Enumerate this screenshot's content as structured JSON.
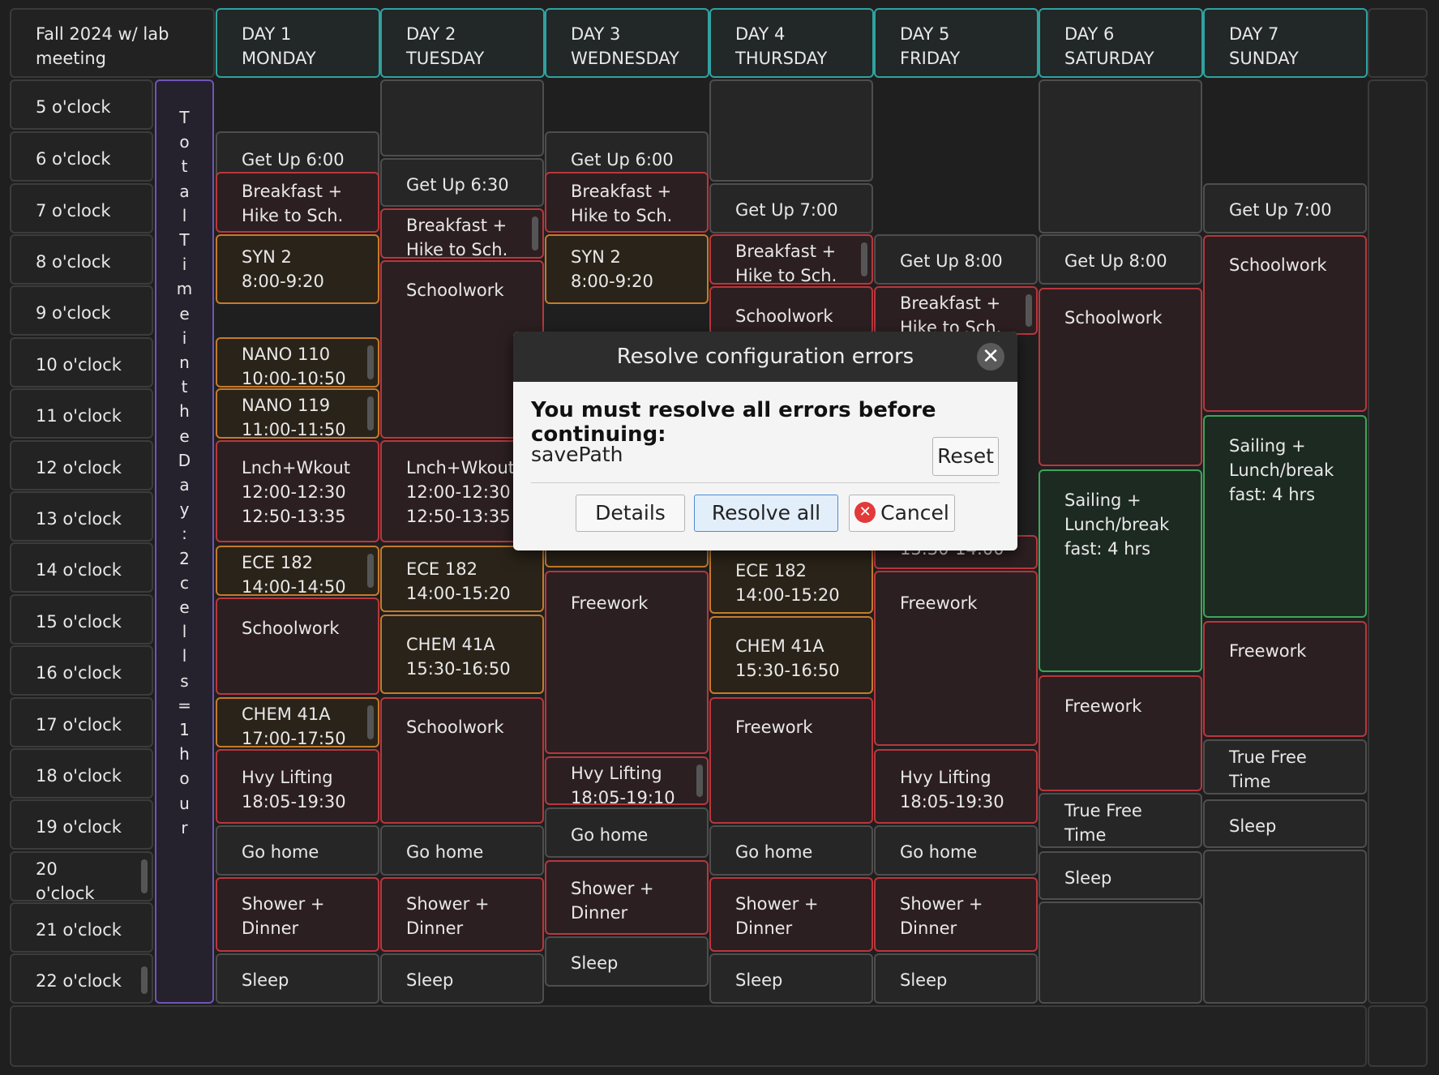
{
  "header": {
    "corner_title": "Fall 2024 w/ lab\nmeeting",
    "days": [
      {
        "line1": "DAY 1",
        "line2": "MONDAY"
      },
      {
        "line1": "DAY 2",
        "line2": "TUESDAY"
      },
      {
        "line1": "DAY 3",
        "line2": "WEDNESDAY"
      },
      {
        "line1": "DAY 4",
        "line2": "THURSDAY"
      },
      {
        "line1": "DAY 5",
        "line2": "FRIDAY"
      },
      {
        "line1": "DAY 6",
        "line2": "SATURDAY"
      },
      {
        "line1": "DAY 7",
        "line2": "SUNDAY"
      }
    ]
  },
  "hours": [
    "5 o'clock",
    "6 o'clock",
    "7 o'clock",
    "8 o'clock",
    "9 o'clock",
    "10 o'clock",
    "11 o'clock",
    "12 o'clock",
    "13 o'clock",
    "14 o'clock",
    "15 o'clock",
    "16 o'clock",
    "17 o'clock",
    "18 o'clock",
    "19 o'clock",
    "20\no'clock",
    "21 o'clock",
    "22 o'clock"
  ],
  "vertical_note": "TotalTimeintheDay:2cells=1hour",
  "schedule": {
    "day1": [
      "Get Up 6:00",
      "Breakfast +\nHike to Sch.",
      "SYN 2\n8:00-9:20",
      "NANO 110\n10:00-10:50",
      "NANO 119\n11:00-11:50",
      "Lnch+Wkout\n12:00-12:30\n12:50-13:35",
      "ECE 182\n14:00-14:50",
      "Schoolwork",
      "CHEM 41A\n17:00-17:50",
      "Hvy Lifting\n18:05-19:30",
      "Go home",
      "Shower +\nDinner",
      "Sleep"
    ],
    "day2": [
      "Get Up 6:30",
      "Breakfast +\nHike to Sch.",
      "Schoolwork",
      "Lnch+Wkout\n12:00-12:30\n12:50-13:35",
      "ECE 182\n14:00-15:20",
      "CHEM 41A\n15:30-16:50",
      "Schoolwork",
      "Go home",
      "Shower +\nDinner",
      "Sleep"
    ],
    "day3": [
      "Get Up 6:00",
      "Breakfast +\nHike to Sch.",
      "SYN 2\n8:00-9:20",
      "Freework",
      "Hvy Lifting\n18:05-19:10",
      "Go home",
      "Shower +\nDinner",
      "Sleep"
    ],
    "day4": [
      "Get Up 7:00",
      "Breakfast +\nHike to Sch.",
      "Schoolwork",
      "ECE 182\n14:00-15:20",
      "CHEM 41A\n15:30-16:50",
      "Freework",
      "Go home",
      "Shower +\nDinner",
      "Sleep"
    ],
    "day5": [
      "Get Up 8:00",
      "Breakfast +\nHike to Sch.",
      "13:30-14:00",
      "Freework",
      "Hvy Lifting\n18:05-19:30",
      "Go home",
      "Shower +\nDinner",
      "Sleep"
    ],
    "day6": [
      "Get Up 8:00",
      "Schoolwork",
      "Sailing +\nLunch/break\nfast: 4 hrs",
      "Freework",
      "True Free\nTime",
      "Sleep"
    ],
    "day7": [
      "Get Up 7:00",
      "Schoolwork",
      "Sailing +\nLunch/break\nfast: 4 hrs",
      "Freework",
      "True Free\nTime",
      "Sleep"
    ]
  },
  "dialog": {
    "title": "Resolve configuration errors",
    "message": "You must resolve all errors before continuing:",
    "error_item": "savePath",
    "reset_label": "Reset",
    "details_label": "Details",
    "resolve_all_label": "Resolve all",
    "cancel_label": "Cancel"
  },
  "colors": {
    "red_border": "#b8373d",
    "orange_border": "#c47b2c",
    "green_border": "#3ea55a",
    "teal_border": "#2fa2a0",
    "purple_border": "#6e56b8"
  }
}
